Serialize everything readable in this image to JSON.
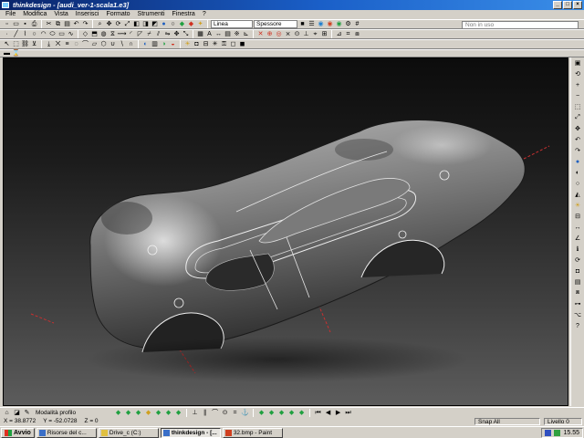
{
  "window": {
    "title": "thinkdesign - [audi_ver-1-scala1.e3]",
    "min_glyph": "_",
    "max_glyph": "□",
    "close_glyph": "×"
  },
  "menu": {
    "items": [
      "File",
      "Modifica",
      "Vista",
      "Inserisci",
      "Formato",
      "Strumenti",
      "Finestra",
      "?"
    ]
  },
  "toolbar": {
    "line_style": "Linea",
    "thickness": "Spessore",
    "search_placeholder": "Non in uso"
  },
  "bottom_toolbar": {
    "profile_mode": "Modalità profilo"
  },
  "status": {
    "x": "X = 38.8772",
    "y": "Y = -52.0728",
    "z": "Z = 0",
    "snap": "Snap All",
    "level": "Livello 0"
  },
  "taskbar": {
    "start": "Avvio",
    "tasks": [
      {
        "label": "Risorse del c...",
        "active": false
      },
      {
        "label": "Drive_c (C:)",
        "active": false
      },
      {
        "label": "thinkdesign - [...",
        "active": true
      },
      {
        "label": "32.bmp - Paint",
        "active": false
      }
    ],
    "clock": "15.55"
  },
  "icons": {
    "viewport_model": "car-body-3d-model",
    "axis": "axis-marker"
  },
  "colors": {
    "title_start": "#0a246a",
    "title_end": "#3a8ee8",
    "axis_red": "#c83030",
    "edge_white": "#ffffff"
  }
}
